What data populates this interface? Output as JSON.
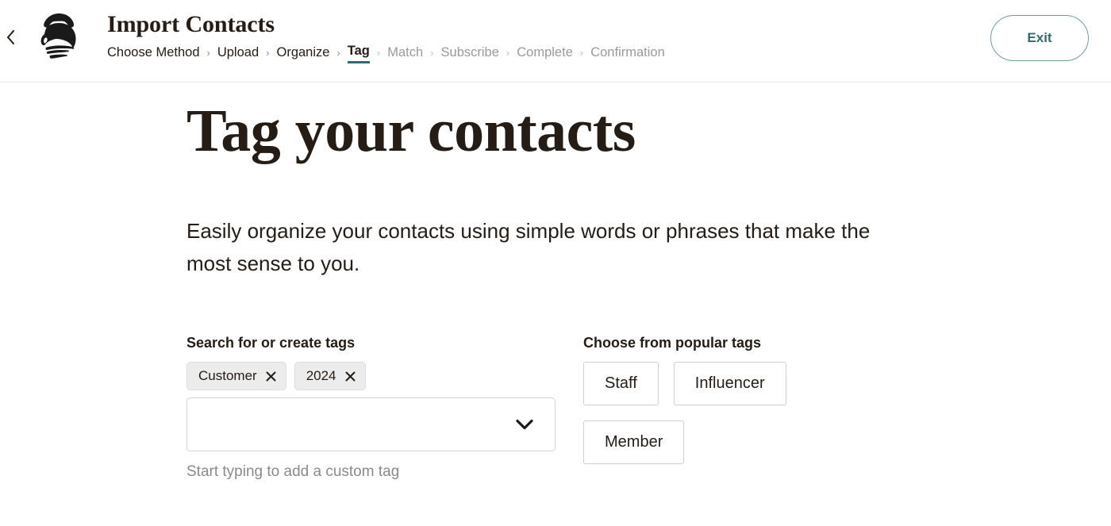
{
  "header": {
    "back_icon": "chevron-left-icon",
    "logo_name": "mailchimp-freddie-logo",
    "title": "Import Contacts",
    "exit_label": "Exit",
    "accent_color": "#2d6b70",
    "exit_border_color": "#6e9ba0",
    "exit_text_color": "#34696d",
    "breadcrumb": [
      {
        "label": "Choose Method",
        "state": "done"
      },
      {
        "label": "Upload",
        "state": "done"
      },
      {
        "label": "Organize",
        "state": "done"
      },
      {
        "label": "Tag",
        "state": "active"
      },
      {
        "label": "Match",
        "state": "upcoming"
      },
      {
        "label": "Subscribe",
        "state": "upcoming"
      },
      {
        "label": "Complete",
        "state": "upcoming"
      },
      {
        "label": "Confirmation",
        "state": "upcoming"
      }
    ],
    "separator": "›"
  },
  "main": {
    "title": "Tag your contacts",
    "description": "Easily organize your contacts using simple words or phrases that make the most sense to you.",
    "search_section": {
      "label": "Search for or create tags",
      "chips": [
        {
          "label": "Customer",
          "remove_icon": "close-icon"
        },
        {
          "label": "2024",
          "remove_icon": "close-icon"
        }
      ],
      "input_value": "",
      "input_placeholder": "",
      "chevron_icon": "chevron-down-icon",
      "helper_text": "Start typing to add a custom tag"
    },
    "popular_section": {
      "label": "Choose from popular tags",
      "tags": [
        {
          "label": "Staff"
        },
        {
          "label": "Influencer"
        },
        {
          "label": "Member"
        }
      ]
    }
  }
}
